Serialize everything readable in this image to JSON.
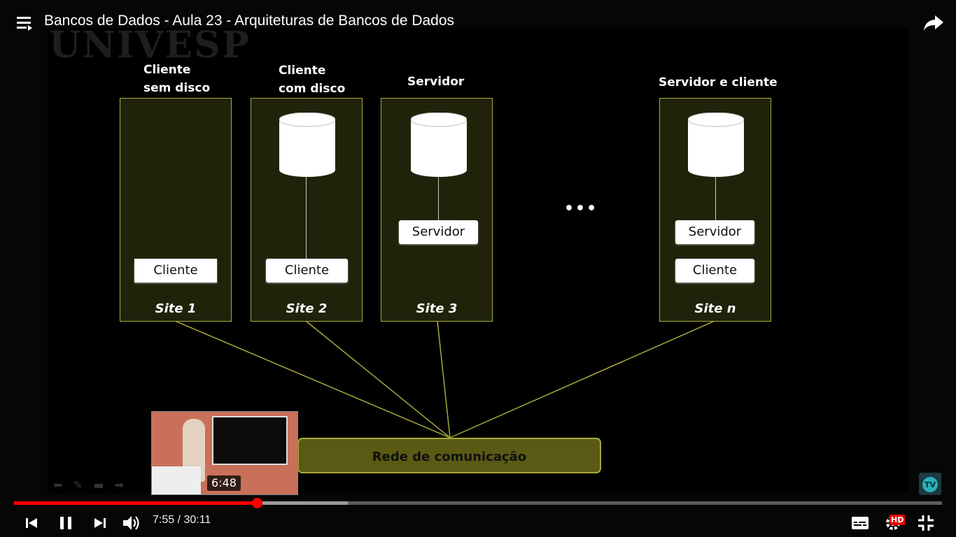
{
  "video": {
    "title": "Bancos de Dados - Aula 23 - Arquiteturas de Bancos de Dados",
    "current_time": "7:55",
    "duration": "30:11",
    "time_display": "7:55 / 30:11",
    "progress_fraction": 0.2617,
    "buffered_fraction": 0.36,
    "preview_time": "6:48",
    "quality_badge": "HD"
  },
  "slide": {
    "watermark": "UNIVESP",
    "headings": {
      "site1": [
        "Cliente",
        "sem disco"
      ],
      "site2": [
        "Cliente",
        "com disco"
      ],
      "site3": "Servidor",
      "siten": "Servidor e cliente"
    },
    "site_labels": [
      "Site 1",
      "Site 2",
      "Site 3",
      "Site n"
    ],
    "boxes": {
      "cliente": "Cliente",
      "servidor": "Servidor"
    },
    "ellipsis": "•••",
    "network": "Rede de comunicação"
  },
  "colors": {
    "site_border": "#a8a83a",
    "site_fill": "#202309",
    "network_fill": "#5a5a14",
    "progress_played": "#ff0000"
  },
  "icons": [
    "menu-icon",
    "share-icon",
    "previous-icon",
    "pause-icon",
    "next-icon",
    "volume-icon",
    "subtitles-icon",
    "settings-icon",
    "exit-fullscreen-icon"
  ]
}
